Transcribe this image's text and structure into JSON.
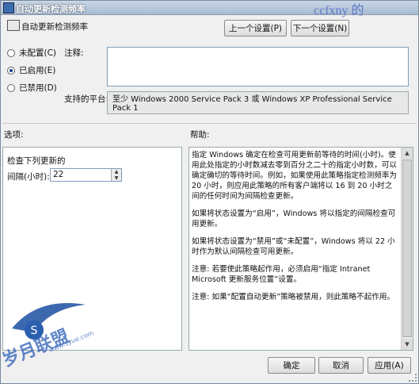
{
  "window": {
    "title": "自动更新检测频率"
  },
  "watermark_top": "ccfxny 的",
  "header": {
    "policy_title": "自动更新检测频率"
  },
  "nav": {
    "prev_label": "上一个设置(P)",
    "next_label": "下一个设置(N)"
  },
  "state": {
    "options": [
      {
        "label": "未配置(C)",
        "checked": false
      },
      {
        "label": "已启用(E)",
        "checked": true
      },
      {
        "label": "已禁用(D)",
        "checked": false
      }
    ]
  },
  "comment": {
    "label": "注释:",
    "value": ""
  },
  "platform": {
    "label": "支持的平台:",
    "value": "至少 Windows 2000 Service Pack 3 或 Windows XP Professional Service Pack 1"
  },
  "options_section": {
    "label": "选项:",
    "check_label": "检查下列更新的",
    "interval_label": "间隔(小时):",
    "interval_value": "22"
  },
  "help_section": {
    "label": "帮助:",
    "paragraphs": [
      "指定 Windows 确定在检查可用更新前等待的时间(小时)。使用此处指定的小时数减去零到百分之二十的指定小时数，可以确定确切的等待时间。例如，如果使用此策略指定检测频率为 20 小时，则应用此策略的所有客户端将以 16 到 20 小时之间的任何时间为间隔检查更新。",
      "如果将状态设置为“启用”，Windows 将以指定的间隔检查可用更新。",
      "如果将状态设置为“禁用”或“未配置”，Windows 将以 22 小时作为默认间隔检查可用更新。",
      "注意: 若要使此策略起作用，必须启用“指定 Intranet Microsoft 更新服务位置”设置。",
      "注意: 如果“配置自动更新”策略被禁用，则此策略不起作用。"
    ]
  },
  "buttons": {
    "ok": "确定",
    "cancel": "取消",
    "apply": "应用(A)"
  },
  "watermark_logo": {
    "main": "岁月联盟",
    "sub": "www.syue.com"
  },
  "colors": {
    "title_bar": "#a9bcd3",
    "accent": "#1a3f8a",
    "watermark": "#5f78c8"
  }
}
